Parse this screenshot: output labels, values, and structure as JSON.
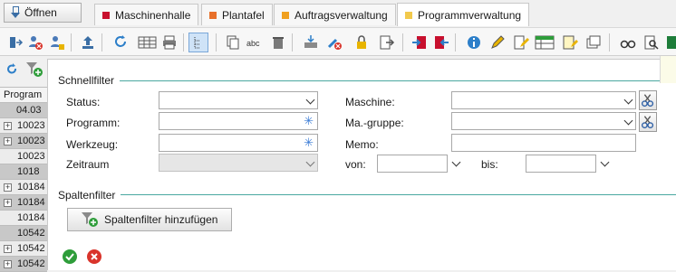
{
  "header": {
    "open_label": "Öffnen",
    "tabs": [
      {
        "label": "Maschinenhalle",
        "color": "#c8102e"
      },
      {
        "label": "Plantafel",
        "color": "#e8702a"
      },
      {
        "label": "Auftragsverwaltung",
        "color": "#f0a020"
      },
      {
        "label": "Programmverwaltung",
        "color": "#f2c94c",
        "active": true
      }
    ]
  },
  "toolbar": {
    "icons": [
      "import-icon",
      "user-remove-icon",
      "user-lock-icon",
      "upload-icon",
      "refresh-icon",
      "grid-icon",
      "print-icon",
      "tree-view-icon",
      "copy-icon",
      "rename-icon",
      "delete-icon",
      "machine-transfer-icon",
      "settings-remove-icon",
      "lock-icon",
      "export-icon",
      "move-in-icon",
      "move-out-icon",
      "info-icon",
      "edit-icon",
      "doc-edit-icon",
      "table-icon",
      "notes-icon",
      "duplicate-icon",
      "view-icon",
      "search-doc-icon",
      "excel-icon"
    ]
  },
  "grid": {
    "header": "Program",
    "rows": [
      {
        "value": "04.03",
        "expand": false
      },
      {
        "value": "10023",
        "expand": true
      },
      {
        "value": "10023",
        "expand": true
      },
      {
        "value": "10023",
        "expand": false
      },
      {
        "value": "1018",
        "expand": false
      },
      {
        "value": "10184",
        "expand": true
      },
      {
        "value": "10184",
        "expand": true
      },
      {
        "value": "10184",
        "expand": false
      },
      {
        "value": "10542",
        "expand": false
      },
      {
        "value": "10542",
        "expand": true
      },
      {
        "value": "10542",
        "expand": true
      },
      {
        "value": "10542",
        "expand": true
      }
    ]
  },
  "filter": {
    "quick_title": "Schnellfilter",
    "status_label": "Status:",
    "program_label": "Programm:",
    "tool_label": "Werkzeug:",
    "period_label": "Zeitraum",
    "machine_label": "Maschine:",
    "machine_group_label": "Ma.-gruppe:",
    "memo_label": "Memo:",
    "from_label": "von:",
    "to_label": "bis:",
    "column_title": "Spaltenfilter",
    "add_column_filter": "Spaltenfilter hinzufügen",
    "status_value": "",
    "program_value": "",
    "tool_value": "",
    "period_value": "",
    "machine_value": "",
    "machine_group_value": "",
    "memo_value": "",
    "from_value": "",
    "to_value": "",
    "accent_color": "#4aa8a0",
    "confirm_color": "#2e9d3a",
    "cancel_color": "#d9342b"
  }
}
